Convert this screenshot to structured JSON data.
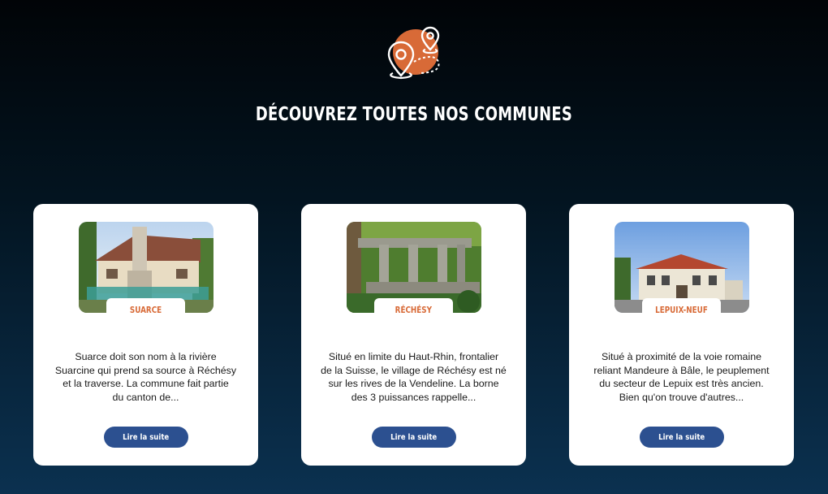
{
  "header": {
    "title": "DÉCOUVREZ TOUTES NOS COMMUNES",
    "icon": "map-pins-icon",
    "accent_color": "#d86a37"
  },
  "communes": [
    {
      "name": "SUARCE",
      "description_lines": [
        "Suarce doit son nom à la rivière",
        "Suarcine qui prend sa source à Réchésy",
        "et la traverse. La commune fait partie",
        "du canton de..."
      ],
      "button_label": "Lire la suite"
    },
    {
      "name": "RÉCHÉSY",
      "description_lines": [
        "Situé en limite du Haut-Rhin, frontalier",
        "de la Suisse, le village de Réchésy est né",
        "sur les rives de la Vendeline. La borne",
        "des 3 puissances rappelle..."
      ],
      "button_label": "Lire la suite"
    },
    {
      "name": "LEPUIX-NEUF",
      "description_lines": [
        "Situé à proximité de la voie romaine",
        "reliant Mandeure à Bâle, le peuplement",
        "du secteur de Lepuix est très ancien.",
        "Bien qu'on trouve d'autres..."
      ],
      "button_label": "Lire la suite"
    }
  ],
  "colors": {
    "button": "#2c5090",
    "card": "#ffffff",
    "tag_text": "#d86a37"
  }
}
